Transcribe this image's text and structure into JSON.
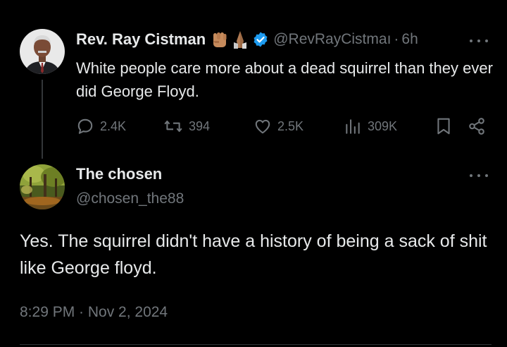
{
  "tweet": {
    "display_name": "Rev. Ray Cistman",
    "emoji_icons": [
      "raised-fist-icon",
      "folded-hands-icon"
    ],
    "verified_color": "#1d9bf0",
    "handle": "@RevRayCistmaı",
    "separator": "·",
    "time": "6h",
    "text": "White people care more about a dead squirrel than they ever did George Floyd.",
    "stats": {
      "replies": "2.4K",
      "reposts": "394",
      "likes": "2.5K",
      "views": "309K"
    }
  },
  "reply": {
    "display_name": "The chosen",
    "handle": "@chosen_the88",
    "text": "Yes. The squirrel didn't have a history of being a sack of shit like George floyd.",
    "timestamp": "8:29 PM · Nov 2, 2024"
  },
  "colors": {
    "background": "#000000",
    "text": "#e7e9ea",
    "muted": "#71767b"
  }
}
